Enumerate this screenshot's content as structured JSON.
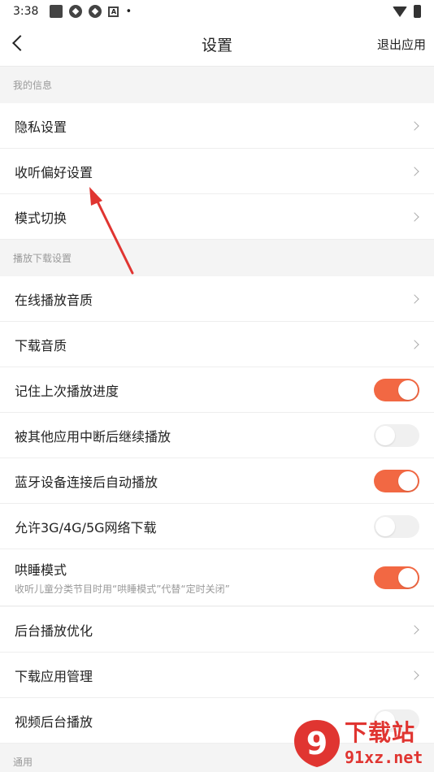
{
  "status_bar": {
    "time": "3:38"
  },
  "header": {
    "title": "设置",
    "exit_label": "退出应用"
  },
  "sections": {
    "my_info": "我的信息",
    "play_download": "播放下载设置",
    "general": "通用"
  },
  "rows": {
    "privacy": "隐私设置",
    "listen_pref": "收听偏好设置",
    "mode_switch": "模式切换",
    "online_quality": "在线播放音质",
    "download_quality": "下载音质",
    "remember_progress": "记住上次播放进度",
    "resume_after_interrupt": "被其他应用中断后继续播放",
    "bluetooth_autoplay": "蓝牙设备连接后自动播放",
    "allow_mobile_download": "允许3G/4G/5G网络下载",
    "sleep_mode": "哄睡模式",
    "sleep_mode_desc": "收听儿童分类节目时用“哄睡模式”代替“定时关闭”",
    "bg_play_opt": "后台播放优化",
    "download_app_mgmt": "下载应用管理",
    "video_bg_play": "视频后台播放"
  },
  "toggles": {
    "remember_progress": true,
    "resume_after_interrupt": false,
    "bluetooth_autoplay": true,
    "allow_mobile_download": false,
    "sleep_mode": true,
    "video_bg_play": false
  },
  "colors": {
    "accent": "#f26843",
    "annotation_arrow": "#e03531"
  },
  "watermark": {
    "text": "下载站",
    "url": "91xz.net",
    "logo_glyph": "9"
  }
}
